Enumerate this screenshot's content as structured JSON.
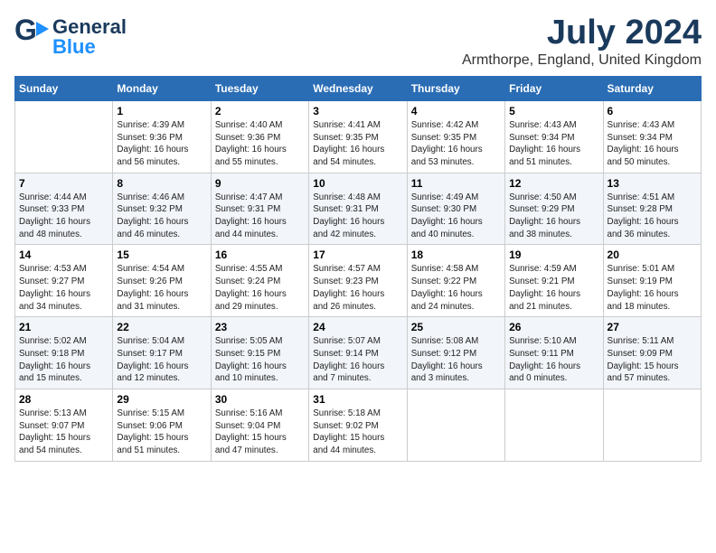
{
  "logo": {
    "line1": "General",
    "line2": "Blue"
  },
  "title": {
    "month": "July 2024",
    "location": "Armthorpe, England, United Kingdom"
  },
  "weekdays": [
    "Sunday",
    "Monday",
    "Tuesday",
    "Wednesday",
    "Thursday",
    "Friday",
    "Saturday"
  ],
  "weeks": [
    [
      {
        "day": "",
        "info": ""
      },
      {
        "day": "1",
        "info": "Sunrise: 4:39 AM\nSunset: 9:36 PM\nDaylight: 16 hours\nand 56 minutes."
      },
      {
        "day": "2",
        "info": "Sunrise: 4:40 AM\nSunset: 9:36 PM\nDaylight: 16 hours\nand 55 minutes."
      },
      {
        "day": "3",
        "info": "Sunrise: 4:41 AM\nSunset: 9:35 PM\nDaylight: 16 hours\nand 54 minutes."
      },
      {
        "day": "4",
        "info": "Sunrise: 4:42 AM\nSunset: 9:35 PM\nDaylight: 16 hours\nand 53 minutes."
      },
      {
        "day": "5",
        "info": "Sunrise: 4:43 AM\nSunset: 9:34 PM\nDaylight: 16 hours\nand 51 minutes."
      },
      {
        "day": "6",
        "info": "Sunrise: 4:43 AM\nSunset: 9:34 PM\nDaylight: 16 hours\nand 50 minutes."
      }
    ],
    [
      {
        "day": "7",
        "info": "Sunrise: 4:44 AM\nSunset: 9:33 PM\nDaylight: 16 hours\nand 48 minutes."
      },
      {
        "day": "8",
        "info": "Sunrise: 4:46 AM\nSunset: 9:32 PM\nDaylight: 16 hours\nand 46 minutes."
      },
      {
        "day": "9",
        "info": "Sunrise: 4:47 AM\nSunset: 9:31 PM\nDaylight: 16 hours\nand 44 minutes."
      },
      {
        "day": "10",
        "info": "Sunrise: 4:48 AM\nSunset: 9:31 PM\nDaylight: 16 hours\nand 42 minutes."
      },
      {
        "day": "11",
        "info": "Sunrise: 4:49 AM\nSunset: 9:30 PM\nDaylight: 16 hours\nand 40 minutes."
      },
      {
        "day": "12",
        "info": "Sunrise: 4:50 AM\nSunset: 9:29 PM\nDaylight: 16 hours\nand 38 minutes."
      },
      {
        "day": "13",
        "info": "Sunrise: 4:51 AM\nSunset: 9:28 PM\nDaylight: 16 hours\nand 36 minutes."
      }
    ],
    [
      {
        "day": "14",
        "info": "Sunrise: 4:53 AM\nSunset: 9:27 PM\nDaylight: 16 hours\nand 34 minutes."
      },
      {
        "day": "15",
        "info": "Sunrise: 4:54 AM\nSunset: 9:26 PM\nDaylight: 16 hours\nand 31 minutes."
      },
      {
        "day": "16",
        "info": "Sunrise: 4:55 AM\nSunset: 9:24 PM\nDaylight: 16 hours\nand 29 minutes."
      },
      {
        "day": "17",
        "info": "Sunrise: 4:57 AM\nSunset: 9:23 PM\nDaylight: 16 hours\nand 26 minutes."
      },
      {
        "day": "18",
        "info": "Sunrise: 4:58 AM\nSunset: 9:22 PM\nDaylight: 16 hours\nand 24 minutes."
      },
      {
        "day": "19",
        "info": "Sunrise: 4:59 AM\nSunset: 9:21 PM\nDaylight: 16 hours\nand 21 minutes."
      },
      {
        "day": "20",
        "info": "Sunrise: 5:01 AM\nSunset: 9:19 PM\nDaylight: 16 hours\nand 18 minutes."
      }
    ],
    [
      {
        "day": "21",
        "info": "Sunrise: 5:02 AM\nSunset: 9:18 PM\nDaylight: 16 hours\nand 15 minutes."
      },
      {
        "day": "22",
        "info": "Sunrise: 5:04 AM\nSunset: 9:17 PM\nDaylight: 16 hours\nand 12 minutes."
      },
      {
        "day": "23",
        "info": "Sunrise: 5:05 AM\nSunset: 9:15 PM\nDaylight: 16 hours\nand 10 minutes."
      },
      {
        "day": "24",
        "info": "Sunrise: 5:07 AM\nSunset: 9:14 PM\nDaylight: 16 hours\nand 7 minutes."
      },
      {
        "day": "25",
        "info": "Sunrise: 5:08 AM\nSunset: 9:12 PM\nDaylight: 16 hours\nand 3 minutes."
      },
      {
        "day": "26",
        "info": "Sunrise: 5:10 AM\nSunset: 9:11 PM\nDaylight: 16 hours\nand 0 minutes."
      },
      {
        "day": "27",
        "info": "Sunrise: 5:11 AM\nSunset: 9:09 PM\nDaylight: 15 hours\nand 57 minutes."
      }
    ],
    [
      {
        "day": "28",
        "info": "Sunrise: 5:13 AM\nSunset: 9:07 PM\nDaylight: 15 hours\nand 54 minutes."
      },
      {
        "day": "29",
        "info": "Sunrise: 5:15 AM\nSunset: 9:06 PM\nDaylight: 15 hours\nand 51 minutes."
      },
      {
        "day": "30",
        "info": "Sunrise: 5:16 AM\nSunset: 9:04 PM\nDaylight: 15 hours\nand 47 minutes."
      },
      {
        "day": "31",
        "info": "Sunrise: 5:18 AM\nSunset: 9:02 PM\nDaylight: 15 hours\nand 44 minutes."
      },
      {
        "day": "",
        "info": ""
      },
      {
        "day": "",
        "info": ""
      },
      {
        "day": "",
        "info": ""
      }
    ]
  ]
}
